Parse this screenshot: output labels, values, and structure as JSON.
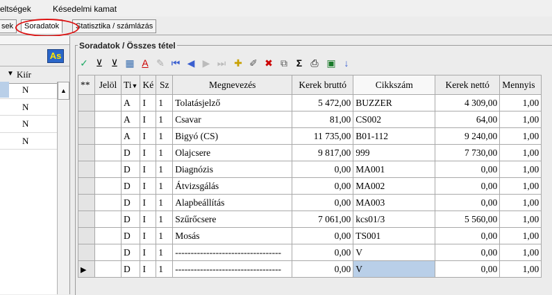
{
  "menu": {
    "item1": "eltségek",
    "item2": "Késedelmi kamat"
  },
  "tabs": {
    "left_partial": "sek",
    "active": "Soradatok",
    "next": "Statisztika / számlázás"
  },
  "left_panel": {
    "as_label": "As",
    "header_kiir": "Kiír",
    "rows": [
      "N",
      "N",
      "N",
      "N"
    ]
  },
  "group_label": "Soradatok / Összes tétel",
  "grid": {
    "headers": [
      "**",
      "Jelöl",
      "Ti",
      "Ké",
      "Sz",
      "Megnevezés",
      "Kerek bruttó",
      "Cikkszám",
      "Kerek nettó",
      "Mennyis"
    ],
    "rows": [
      {
        "ti": "A",
        "ke": "I",
        "sz": "1",
        "name": "Tolatásjelző",
        "brutto": "5 472,00",
        "cikk": "BUZZER",
        "netto": "4 309,00",
        "menny": "1,00"
      },
      {
        "ti": "A",
        "ke": "I",
        "sz": "1",
        "name": "Csavar",
        "brutto": "81,00",
        "cikk": "CS002",
        "netto": "64,00",
        "menny": "1,00"
      },
      {
        "ti": "A",
        "ke": "I",
        "sz": "1",
        "name": "Bigyó (CS)",
        "brutto": "11 735,00",
        "cikk": "B01-112",
        "netto": "9 240,00",
        "menny": "1,00"
      },
      {
        "ti": "D",
        "ke": "I",
        "sz": "1",
        "name": "Olajcsere",
        "brutto": "9 817,00",
        "cikk": "999",
        "netto": "7 730,00",
        "menny": "1,00"
      },
      {
        "ti": "D",
        "ke": "I",
        "sz": "1",
        "name": "Diagnózis",
        "brutto": "0,00",
        "cikk": "MA001",
        "netto": "0,00",
        "menny": "1,00"
      },
      {
        "ti": "D",
        "ke": "I",
        "sz": "1",
        "name": "Átvizsgálás",
        "brutto": "0,00",
        "cikk": "MA002",
        "netto": "0,00",
        "menny": "1,00"
      },
      {
        "ti": "D",
        "ke": "I",
        "sz": "1",
        "name": "Alapbeállítás",
        "brutto": "0,00",
        "cikk": "MA003",
        "netto": "0,00",
        "menny": "1,00"
      },
      {
        "ti": "D",
        "ke": "I",
        "sz": "1",
        "name": "Szűrőcsere",
        "brutto": "7 061,00",
        "cikk": "kcs01/3",
        "netto": "5 560,00",
        "menny": "1,00"
      },
      {
        "ti": "D",
        "ke": "I",
        "sz": "1",
        "name": "Mosás",
        "brutto": "0,00",
        "cikk": "TS001",
        "netto": "0,00",
        "menny": "1,00"
      },
      {
        "ti": "D",
        "ke": "I",
        "sz": "1",
        "name": "----------------------------------",
        "brutto": "0,00",
        "cikk": "V",
        "netto": "0,00",
        "menny": "1,00"
      },
      {
        "ti": "D",
        "ke": "I",
        "sz": "1",
        "name": "----------------------------------",
        "brutto": "0,00",
        "cikk": "V",
        "netto": "0,00",
        "menny": "1,00"
      }
    ]
  }
}
